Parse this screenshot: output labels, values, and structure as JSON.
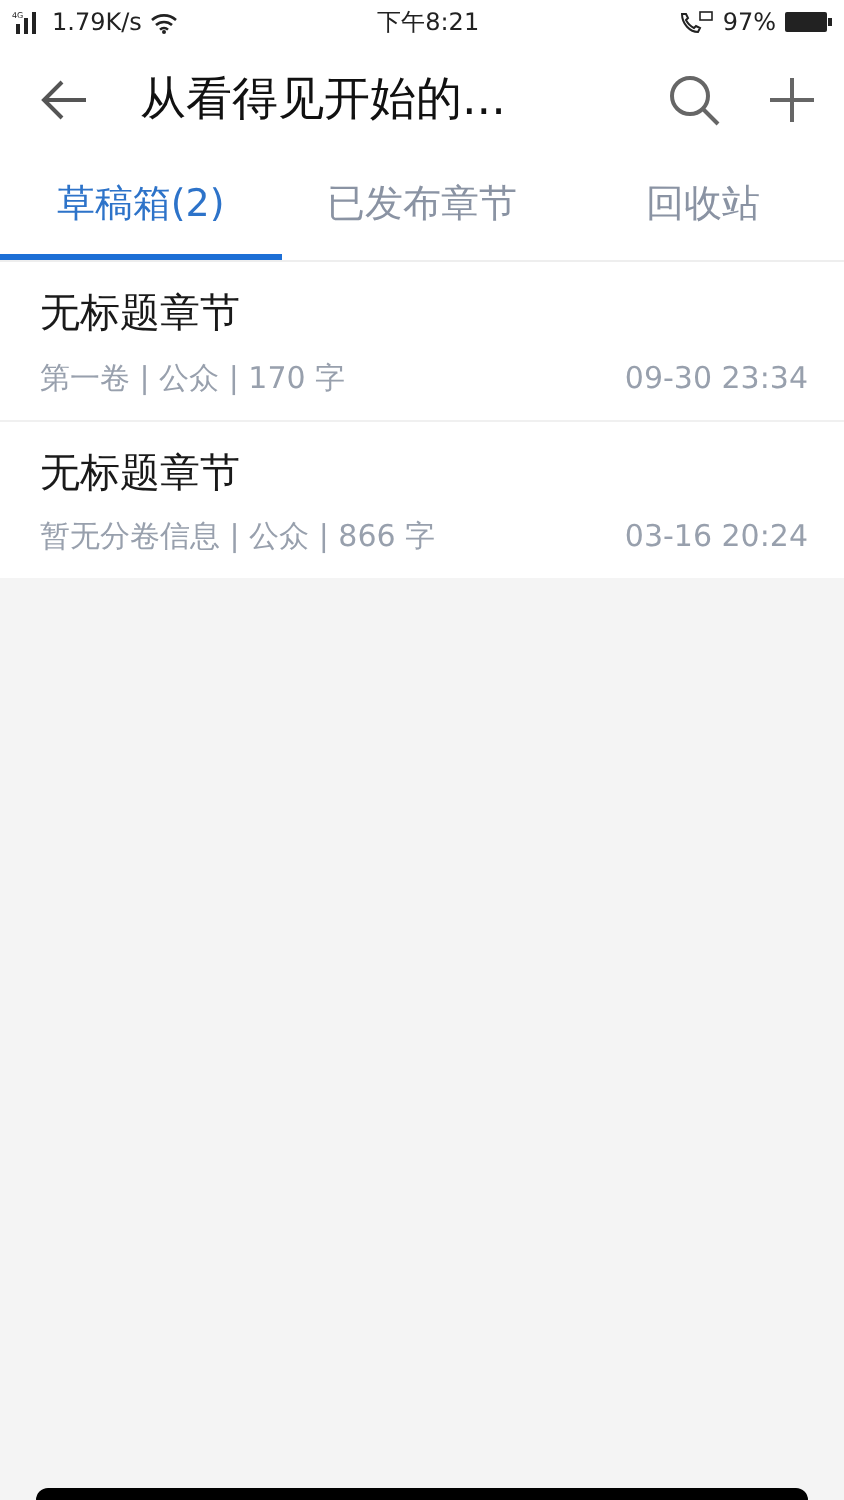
{
  "status_bar": {
    "network": "4G",
    "speed": "1.79K/s",
    "time": "下午8:21",
    "battery": "97%"
  },
  "header": {
    "title": "从看得见开始的..."
  },
  "tabs": [
    {
      "label": "草稿箱(2)",
      "selected": true
    },
    {
      "label": "已发布章节",
      "selected": false
    },
    {
      "label": "回收站",
      "selected": false
    }
  ],
  "chapters": [
    {
      "title": "无标题章节",
      "meta": "第一卷 | 公众 | 170 字",
      "time": "09-30 23:34"
    },
    {
      "title": "无标题章节",
      "meta": "暂无分卷信息 | 公众 | 866 字",
      "time": "03-16 20:24"
    }
  ]
}
